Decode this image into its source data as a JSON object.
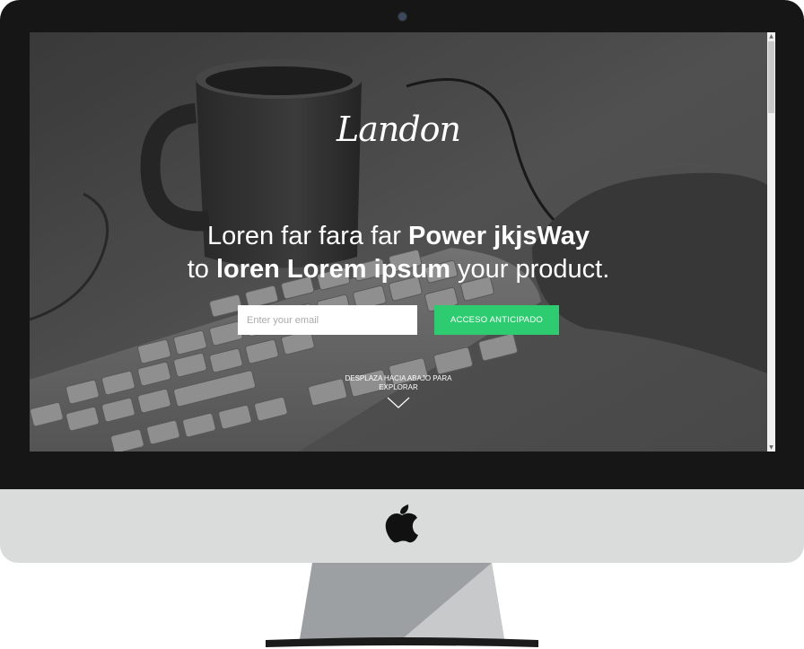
{
  "landing": {
    "logo": "Landon",
    "headline": {
      "line1_pre": "Loren far fara far ",
      "line1_bold": "Power jkjsWay",
      "line2_pre": "to ",
      "line2_bold": "loren Lorem ipsum",
      "line2_post": " your product."
    },
    "signup": {
      "email_placeholder": "Enter your email",
      "button_label": "ACCESO ANTICIPADO"
    },
    "scroll_hint": {
      "line1": "DESPLAZA HACIA ABAJO PARA",
      "line2": "EXPLORAR"
    }
  },
  "colors": {
    "accent_green": "#2ecc71",
    "bezel": "#161616",
    "chin": "#dadbdb"
  },
  "icons": [
    "apple-logo-icon",
    "webcam-icon",
    "chevron-down-icon"
  ]
}
